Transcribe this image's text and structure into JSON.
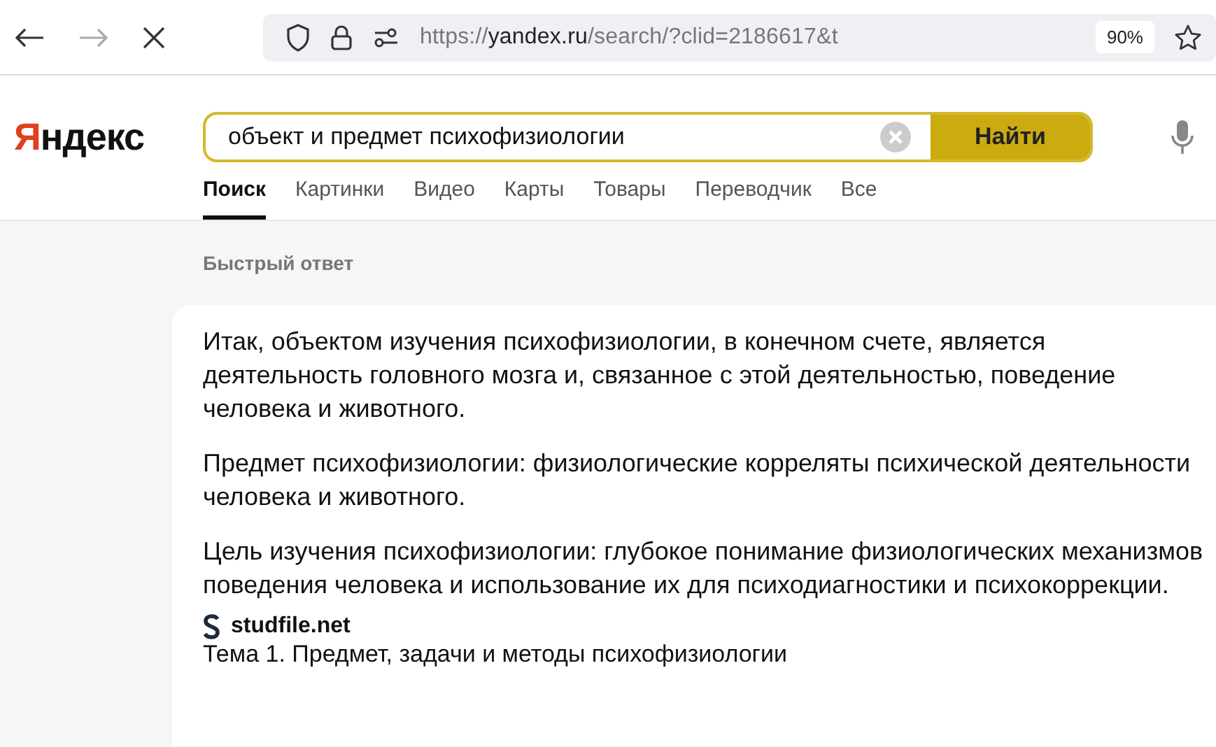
{
  "browser": {
    "url": {
      "scheme": "https://",
      "domain": "yandex.ru",
      "path": "/search/?clid=2186617&t"
    },
    "zoom": "90%",
    "forward_disabled": true
  },
  "logo": {
    "first_letter": "Я",
    "rest": "ндекс"
  },
  "search": {
    "value": "объект и предмет психофизиологии",
    "button": "Найти"
  },
  "tabs": [
    {
      "label": "Поиск",
      "selected": true
    },
    {
      "label": "Картинки",
      "selected": false
    },
    {
      "label": "Видео",
      "selected": false
    },
    {
      "label": "Карты",
      "selected": false
    },
    {
      "label": "Товары",
      "selected": false
    },
    {
      "label": "Переводчик",
      "selected": false
    },
    {
      "label": "Все",
      "selected": false
    }
  ],
  "quick_answer": {
    "heading": "Быстрый ответ",
    "paragraphs": [
      "Итак, объектом изучения психофизиологии, в конечном счете, является деятельность головного мозга и, связанное с этой деятельностью, поведение человека и животного.",
      "Предмет психофизиологии: физиологические корреляты психической деятельности человека и животного.",
      "Цель изучения психофизиологии: глубокое понимание физиологических механизмов поведения человека и использование их для психодиагностики и психокоррекции."
    ],
    "source": {
      "site": "studfile.net",
      "title": "Тема 1. Предмет, задачи и методы психофизиологии"
    }
  }
}
